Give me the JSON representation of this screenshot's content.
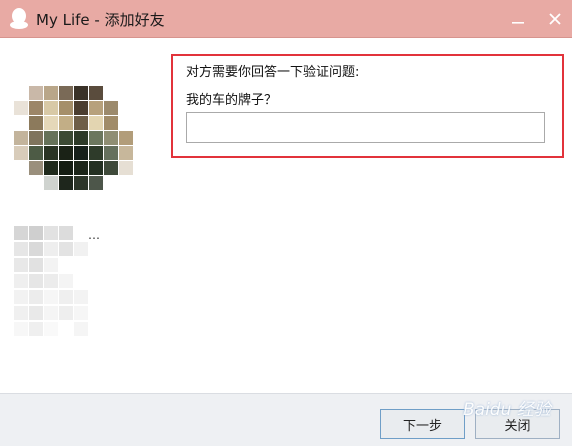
{
  "window": {
    "title": "My Life - 添加好友",
    "minimize_icon": "minimize-icon",
    "close_icon": "close-icon"
  },
  "app_icon": "qq-penguin-icon",
  "verification": {
    "prompt": "对方需要你回答一下验证问题:",
    "question": "我的车的牌子？",
    "answer_value": "",
    "answer_placeholder": ""
  },
  "profile": {
    "name_truncated": "…"
  },
  "footer": {
    "next_label": "下一步",
    "close_label": "关闭"
  },
  "colors": {
    "titlebar": "#e8aaa4",
    "highlight_border": "#e2333b",
    "footer_bg": "#eef0f3"
  }
}
